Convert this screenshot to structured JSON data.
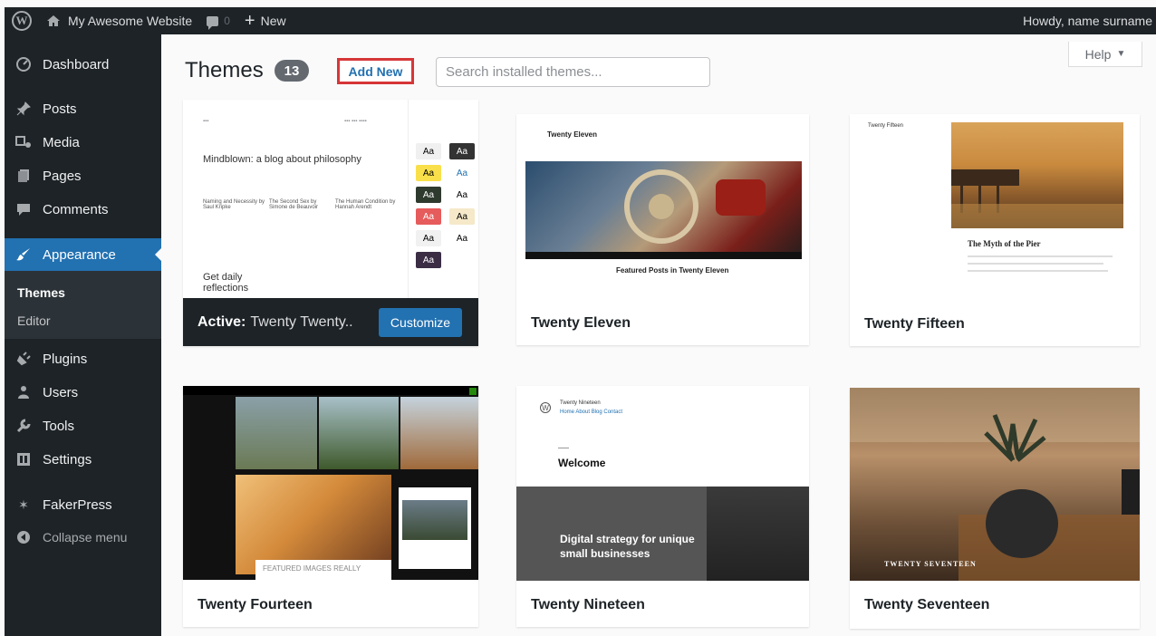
{
  "adminbar": {
    "site_name": "My Awesome Website",
    "comments_count": "0",
    "new_label": "New",
    "greeting": "Howdy, name surname"
  },
  "sidebar": {
    "items": [
      {
        "label": "Dashboard",
        "icon": "dashboard-icon"
      },
      {
        "label": "Posts",
        "icon": "pin-icon"
      },
      {
        "label": "Media",
        "icon": "media-icon"
      },
      {
        "label": "Pages",
        "icon": "pages-icon"
      },
      {
        "label": "Comments",
        "icon": "comment-icon"
      },
      {
        "label": "Appearance",
        "icon": "brush-icon"
      },
      {
        "label": "Plugins",
        "icon": "plug-icon"
      },
      {
        "label": "Users",
        "icon": "users-icon"
      },
      {
        "label": "Tools",
        "icon": "wrench-icon"
      },
      {
        "label": "Settings",
        "icon": "settings-icon"
      },
      {
        "label": "FakerPress",
        "icon": "star-icon"
      }
    ],
    "submenu": [
      "Themes",
      "Editor"
    ],
    "collapse_label": "Collapse menu"
  },
  "header": {
    "title": "Themes",
    "count": "13",
    "add_new": "Add New",
    "search_placeholder": "Search installed themes...",
    "help": "Help"
  },
  "themes": {
    "active": {
      "prefix": "Active:",
      "name": "Twenty Twenty..",
      "customize": "Customize",
      "preview_heading": "Mindblown: a blog about philosophy",
      "preview_posts": [
        "Naming and Necessity by Saul Kripke",
        "The Second Sex by Simone de Beauvoir",
        "The Human Condition by Hannah Arendt"
      ],
      "preview_footer": "Get daily reflections",
      "swatch_label": "Aa"
    },
    "cards": [
      {
        "name": "Twenty Eleven",
        "shot_title": "Twenty Eleven",
        "shot_heading": "Featured Posts in Twenty Eleven"
      },
      {
        "name": "Twenty Fifteen",
        "shot_title": "Twenty Fifteen",
        "shot_heading": "The Myth of the Pier"
      },
      {
        "name": "Twenty Fourteen",
        "shot_heading": "FEATURED IMAGES REALLY"
      },
      {
        "name": "Twenty Nineteen",
        "shot_title": "Twenty Nineteen",
        "shot_nav": "Home  About  Blog  Contact",
        "shot_heading": "Welcome",
        "shot_banner": "Digital strategy for unique small businesses"
      },
      {
        "name": "Twenty Seventeen",
        "shot_heading": "TWENTY SEVENTEEN"
      }
    ]
  },
  "colors": {
    "adminbar": "#1d2327",
    "accent": "#2271b1",
    "add_new_border": "#d63638"
  }
}
